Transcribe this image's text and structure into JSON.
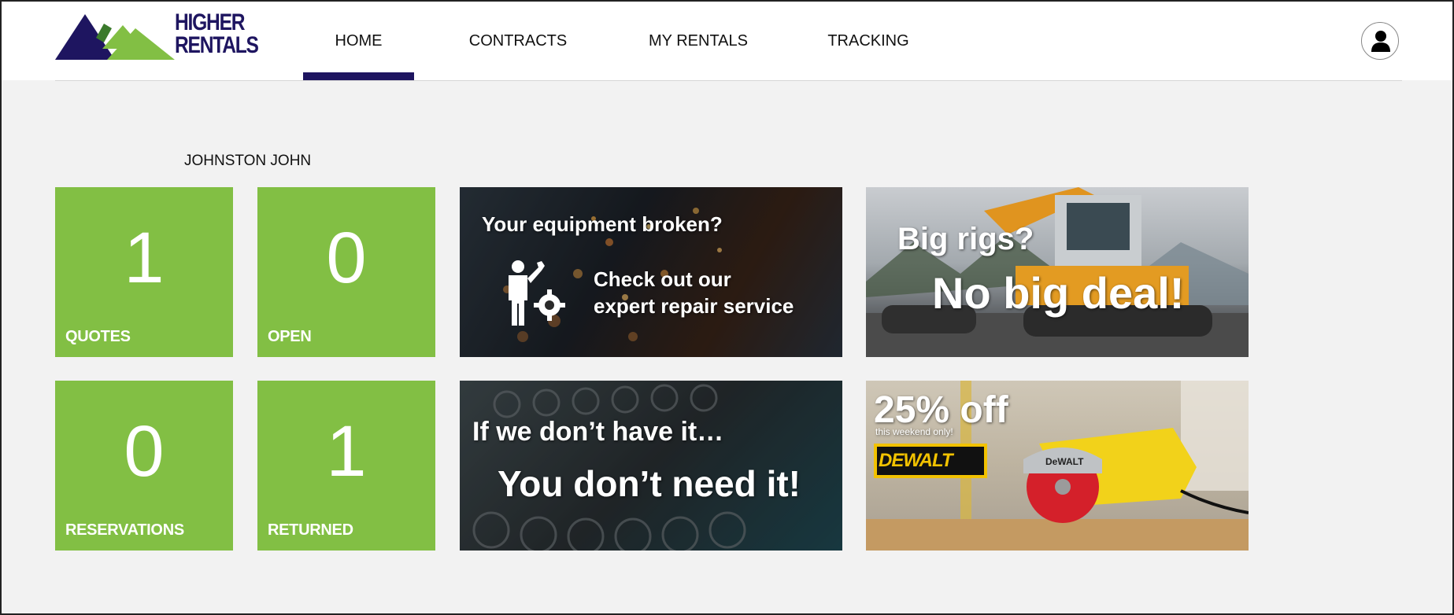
{
  "brand": {
    "line1": "HIGHER",
    "line2": "RENTALS",
    "colors": {
      "navy": "#1e1560",
      "green": "#82bf44",
      "dark_green": "#3b7a2c"
    }
  },
  "nav": {
    "tabs": [
      {
        "label": "HOME",
        "active": true
      },
      {
        "label": "CONTRACTS",
        "active": false
      },
      {
        "label": "MY RENTALS",
        "active": false
      },
      {
        "label": "TRACKING",
        "active": false
      }
    ]
  },
  "user": {
    "name": "JOHNSTON JOHN",
    "avatar_icon": "user-icon"
  },
  "stats": [
    {
      "value": "1",
      "label": "QUOTES"
    },
    {
      "value": "0",
      "label": "OPEN"
    },
    {
      "value": "0",
      "label": "RESERVATIONS"
    },
    {
      "value": "1",
      "label": "RETURNED"
    }
  ],
  "banners": {
    "repair": {
      "headline": "Your equipment broken?",
      "line1": "Check out our",
      "line2": "expert repair service",
      "icon": "mechanic-gear-icon"
    },
    "rigs": {
      "line1": "Big rigs?",
      "line2": "No big deal!"
    },
    "tools": {
      "line1": "If we don’t have it…",
      "line2": "You don’t need it!"
    },
    "promo": {
      "headline": "25% off",
      "subline": "this weekend only!",
      "brand": "DEWALT",
      "saw_brand": "DeWALT"
    }
  }
}
